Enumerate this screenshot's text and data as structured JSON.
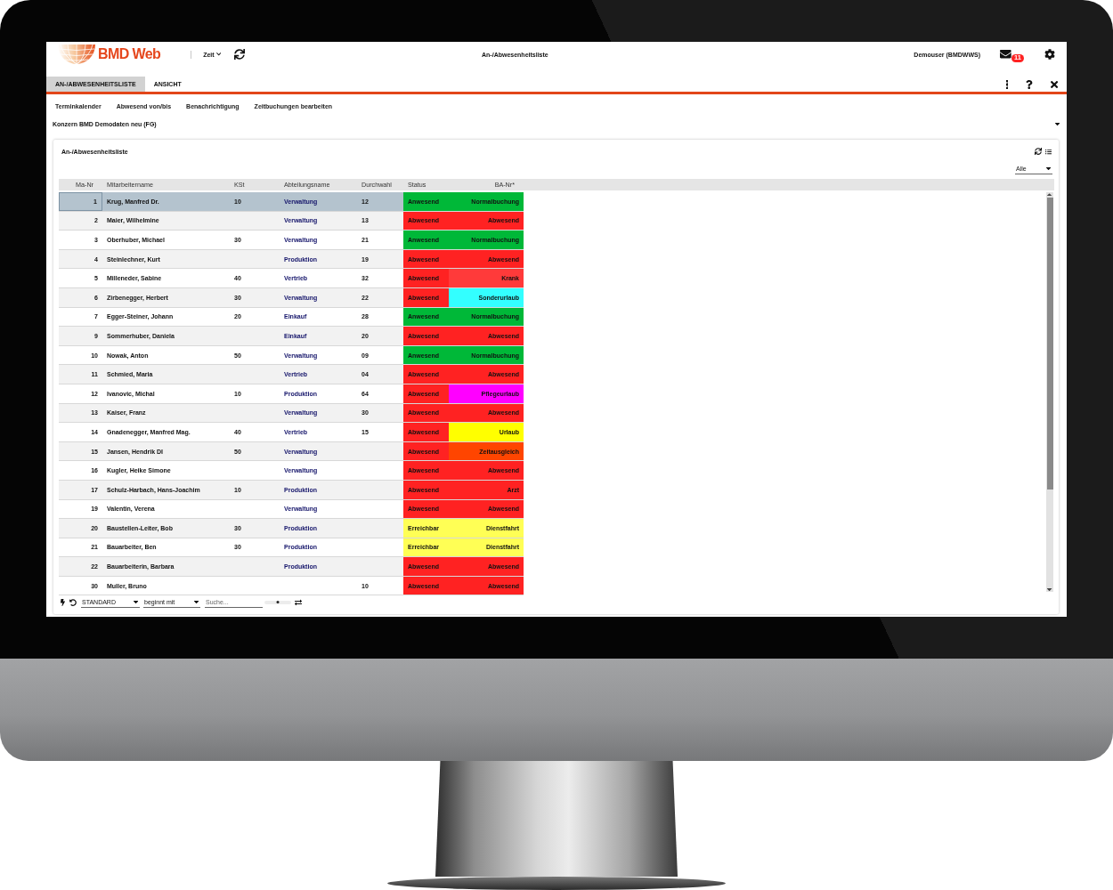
{
  "header": {
    "logo_text": "BMD Web",
    "menu": "Zeit",
    "title": "An-/Abwesenheitsliste",
    "user": "Demouser (BMDWWS)",
    "mail_badge": "11"
  },
  "tabs": [
    {
      "label": "AN-/ABWESENHEITSLISTE",
      "selected": true
    },
    {
      "label": "ANSICHT",
      "selected": false
    }
  ],
  "actions": [
    "Terminkalender",
    "Abwesend von/bis",
    "Benachrichtigung",
    "Zeitbuchungen bearbeiten"
  ],
  "company": "Konzern BMD Demodaten neu (FG)",
  "card": {
    "title": "An-/Abwesenheitsliste",
    "filter": "Alle"
  },
  "table": {
    "columns": [
      "Ma-Nr",
      "Mitarbeitername",
      "KSt",
      "Abteilungsname",
      "Durchwahl",
      "Status",
      "BA-Nr*"
    ],
    "rows": [
      {
        "nr": "1",
        "name": "Krug, Manfred Dr.",
        "kst": "10",
        "dept": "Verwaltung",
        "phone": "12",
        "status": {
          "text": "Anwesend",
          "color": "#00b838"
        },
        "ba": {
          "text": "Normalbuchung",
          "color": "#00b838"
        },
        "selected": true
      },
      {
        "nr": "2",
        "name": "Maier, Wilhelmine",
        "dept": "Verwaltung",
        "phone": "13",
        "status": {
          "text": "Abwesend",
          "color": "#ff2222"
        },
        "ba": {
          "text": "Abwesend",
          "color": "#ff2222"
        },
        "selected": false
      },
      {
        "nr": "3",
        "name": "Oberhuber, Michael",
        "kst": "30",
        "dept": "Verwaltung",
        "phone": "21",
        "status": {
          "text": "Anwesend",
          "color": "#00b838"
        },
        "ba": {
          "text": "Normalbuchung",
          "color": "#00b838"
        },
        "selected": false
      },
      {
        "nr": "4",
        "name": "Steinlechner, Kurt",
        "dept": "Produktion",
        "phone": "19",
        "status": {
          "text": "Abwesend",
          "color": "#ff2222"
        },
        "ba": {
          "text": "Abwesend",
          "color": "#ff2222"
        },
        "selected": false
      },
      {
        "nr": "5",
        "name": "Milleneder, Sabine",
        "kst": "40",
        "dept": "Vertrieb",
        "phone": "32",
        "status": {
          "text": "Abwesend",
          "color": "#ff2222"
        },
        "ba": {
          "text": "Krank",
          "color": "#ff3a3a"
        },
        "selected": false
      },
      {
        "nr": "6",
        "name": "Zirbenegger, Herbert",
        "kst": "30",
        "dept": "Verwaltung",
        "phone": "22",
        "status": {
          "text": "Abwesend",
          "color": "#ff2222"
        },
        "ba": {
          "text": "Sonderurlaub",
          "color": "#33ffff"
        },
        "selected": false
      },
      {
        "nr": "7",
        "name": "Egger-Steiner, Johann",
        "kst": "20",
        "dept": "Einkauf",
        "phone": "28",
        "status": {
          "text": "Anwesend",
          "color": "#00b838"
        },
        "ba": {
          "text": "Normalbuchung",
          "color": "#00b838"
        },
        "selected": false
      },
      {
        "nr": "9",
        "name": "Sommerhuber, Daniela",
        "dept": "Einkauf",
        "phone": "20",
        "status": {
          "text": "Abwesend",
          "color": "#ff2222"
        },
        "ba": {
          "text": "Abwesend",
          "color": "#ff2222"
        },
        "selected": false
      },
      {
        "nr": "10",
        "name": "Nowak, Anton",
        "kst": "50",
        "dept": "Verwaltung",
        "phone": "09",
        "status": {
          "text": "Anwesend",
          "color": "#00b838"
        },
        "ba": {
          "text": "Normalbuchung",
          "color": "#00b838"
        },
        "selected": false
      },
      {
        "nr": "11",
        "name": "Schmied, Maria",
        "dept": "Vertrieb",
        "phone": "04",
        "status": {
          "text": "Abwesend",
          "color": "#ff2222"
        },
        "ba": {
          "text": "Abwesend",
          "color": "#ff2222"
        },
        "selected": false
      },
      {
        "nr": "12",
        "name": "Ivanovic, Michal",
        "kst": "10",
        "dept": "Produktion",
        "phone": "64",
        "status": {
          "text": "Abwesend",
          "color": "#ff2222"
        },
        "ba": {
          "text": "Pflegeurlaub",
          "color": "#ff00ff"
        },
        "selected": false
      },
      {
        "nr": "13",
        "name": "Kaiser, Franz",
        "dept": "Verwaltung",
        "phone": "30",
        "status": {
          "text": "Abwesend",
          "color": "#ff2222"
        },
        "ba": {
          "text": "Abwesend",
          "color": "#ff2222"
        },
        "selected": false
      },
      {
        "nr": "14",
        "name": "Gnadenegger, Manfred Mag.",
        "kst": "40",
        "dept": "Vertrieb",
        "phone": "15",
        "status": {
          "text": "Abwesend",
          "color": "#ff2222"
        },
        "ba": {
          "text": "Urlaub",
          "color": "#ffff00"
        },
        "selected": false
      },
      {
        "nr": "15",
        "name": "Jansen, Hendrik DI",
        "kst": "50",
        "dept": "Verwaltung",
        "status": {
          "text": "Abwesend",
          "color": "#ff2222"
        },
        "ba": {
          "text": "Zeitausgleich",
          "color": "#ff4500"
        },
        "selected": false
      },
      {
        "nr": "16",
        "name": "Kugler, Heike Simone",
        "dept": "Verwaltung",
        "status": {
          "text": "Abwesend",
          "color": "#ff2222"
        },
        "ba": {
          "text": "Abwesend",
          "color": "#ff2222"
        },
        "selected": false
      },
      {
        "nr": "17",
        "name": "Schulz-Harbach, Hans-Joachim",
        "kst": "10",
        "dept": "Produktion",
        "status": {
          "text": "Abwesend",
          "color": "#ff2222"
        },
        "ba": {
          "text": "Arzt",
          "color": "#ff2222"
        },
        "selected": false
      },
      {
        "nr": "19",
        "name": "Valentin, Verena",
        "dept": "Verwaltung",
        "status": {
          "text": "Abwesend",
          "color": "#ff2222"
        },
        "ba": {
          "text": "Abwesend",
          "color": "#ff2222"
        },
        "selected": false
      },
      {
        "nr": "20",
        "name": "Baustellen-Leiter, Bob",
        "kst": "30",
        "dept": "Produktion",
        "status": {
          "text": "Erreichbar",
          "color": "#ffff55"
        },
        "ba": {
          "text": "Dienstfahrt",
          "color": "#ffff55"
        },
        "selected": false
      },
      {
        "nr": "21",
        "name": "Bauarbeiter, Ben",
        "kst": "30",
        "dept": "Produktion",
        "status": {
          "text": "Erreichbar",
          "color": "#ffff55"
        },
        "ba": {
          "text": "Dienstfahrt",
          "color": "#ffff55"
        },
        "selected": false
      },
      {
        "nr": "22",
        "name": "Bauarbeiterin, Barbara",
        "dept": "Produktion",
        "status": {
          "text": "Abwesend",
          "color": "#ff2222"
        },
        "ba": {
          "text": "Abwesend",
          "color": "#ff2222"
        },
        "selected": false
      },
      {
        "nr": "30",
        "name": "Muller, Bruno",
        "phone": "10",
        "status": {
          "text": "Abwesend",
          "color": "#ff2222"
        },
        "ba": {
          "text": "Abwesend",
          "color": "#ff2222"
        },
        "selected": false
      }
    ]
  },
  "footer": {
    "view": "STANDARD",
    "match": "beginnt mit",
    "search": {
      "placeholder": "Suche..."
    },
    "slider": {
      "level": 0.5
    }
  }
}
